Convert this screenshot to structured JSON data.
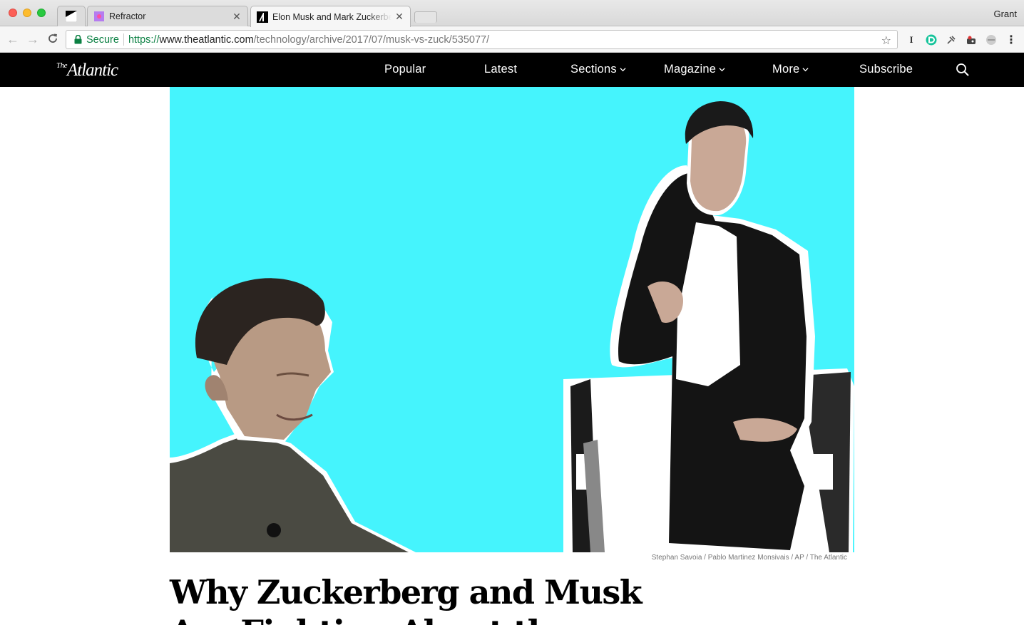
{
  "browser": {
    "tabs": [
      {
        "label": ""
      },
      {
        "label": "Refractor"
      },
      {
        "label": "Elon Musk and Mark Zuckerberg"
      }
    ],
    "profile_name": "Grant",
    "omnibox": {
      "secure_label": "Secure",
      "url_scheme": "https://",
      "url_host": "www.theatlantic.com",
      "url_path": "/technology/archive/2017/07/musk-vs-zuck/535077/"
    },
    "extensions": [
      "I"
    ]
  },
  "site": {
    "logo_the": "The",
    "logo_name": "Atlantic",
    "nav": {
      "popular": "Popular",
      "latest": "Latest",
      "sections": "Sections",
      "magazine": "Magazine",
      "more": "More",
      "subscribe": "Subscribe"
    }
  },
  "article": {
    "image_caption": "Stephan Savoia / Pablo Martinez Monsivais / AP / The Atlantic",
    "headline_line1": "Why Zuckerberg and Musk",
    "headline_line2": "Are Fighting About the"
  },
  "colors": {
    "hero_background": "#45f4fd",
    "nav_background": "#000000",
    "secure_green": "#0b8043"
  }
}
